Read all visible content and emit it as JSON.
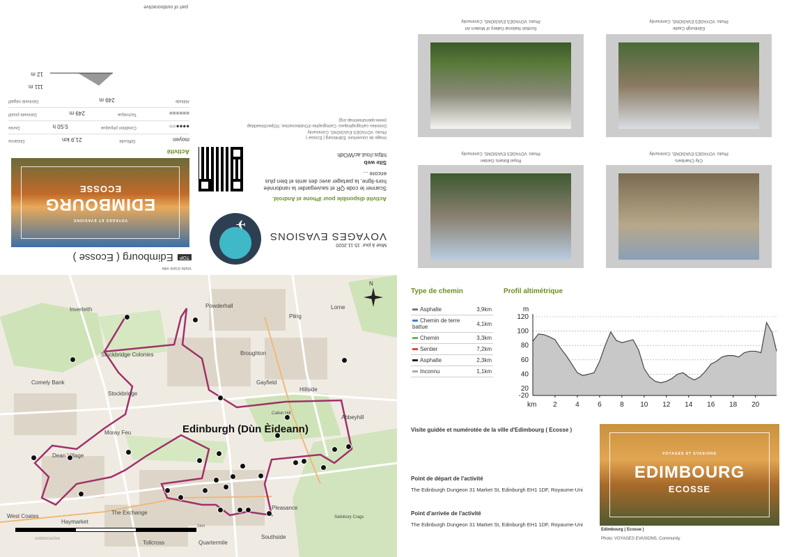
{
  "brand": {
    "part_of": "part of outdooractive",
    "name": "VOYAGES EVASIONS",
    "update": "Mise à jour: 15.11.2020"
  },
  "activity": {
    "category": "Visite d'une ville",
    "badge": "TOP",
    "title": "Edimbourg ( Ecosse )",
    "cover_title": "EDIMBOURG",
    "cover_sub": "ECOSSE",
    "cover_brand": "VOYAGES ET EVASIONS",
    "section": "Activité",
    "stats": [
      {
        "label": "Distance",
        "value": "21,9 km",
        "extra_label": "Difficulté",
        "extra_value": "moyen"
      },
      {
        "label": "Durée",
        "value": "5:50 h",
        "extra_label": "Condition physique",
        "extra_value": ""
      },
      {
        "label": "Dénivelé positif",
        "value": "249 m",
        "extra_label": "Technique",
        "extra_value": ""
      },
      {
        "label": "Dénivelé négatif",
        "value": "249 m",
        "extra_label": "Altitude",
        "extra_value": ""
      }
    ],
    "alt_max": "111 m",
    "alt_min": "12 m"
  },
  "app": {
    "heading": "Activité disponible pour iPhone et Android.",
    "desc": "Scanner le code QR et sauvegarder la randonnée hors-ligne, la partager avec des amis et bien plus encore ...",
    "site_label": "Site web",
    "site_url": "https://out.ac/WOdh",
    "credits1": "Image de couverture: Edimbourg ( Ecosse )",
    "credits2": "Photo: VOYAGES EVASIONS, Community",
    "credits3": "Données cartographiques: Cartographie d'Outdooractive; ©OpenStreetMap",
    "credits4": "(www.openstreetmap.org)"
  },
  "photos": [
    {
      "caption": "Scottish National Gallery of Modern Art",
      "credit": "Photo: VOYAGES EVASIONS, Community"
    },
    {
      "caption": "Edinburgh Castle",
      "credit": "Photo: VOYAGES EVASIONS, Community"
    },
    {
      "caption": "Royal Botanic Garden",
      "credit": "Photo: VOYAGES EVASIONS, Community"
    },
    {
      "caption": "City Chambers",
      "credit": "Photo: VOYAGES EVASIONS, Community"
    }
  ],
  "path_types": {
    "heading": "Type de chemin",
    "rows": [
      {
        "label": "Asphalte",
        "value": "3,9km",
        "color": "#777777"
      },
      {
        "label": "Chemin de terre battue",
        "value": "4,1km",
        "color": "#4a7cc9"
      },
      {
        "label": "Chemin",
        "value": "3,3km",
        "color": "#6bb34a"
      },
      {
        "label": "Sentier",
        "value": "7,2km",
        "color": "#e04040"
      },
      {
        "label": "Asphalte",
        "value": "2,3km",
        "color": "#222222"
      },
      {
        "label": "Inconnu",
        "value": "1,1km",
        "color": "#aaaaaa"
      }
    ]
  },
  "chart_data": {
    "type": "area",
    "title": "Profil altimétrique",
    "xlabel": "km",
    "ylabel": "m",
    "xlim": [
      0,
      21.9
    ],
    "ylim": [
      -20,
      120
    ],
    "xticks": [
      2,
      4,
      6,
      8,
      10,
      12,
      14,
      16,
      18,
      20
    ],
    "yticks": [
      -20,
      20,
      40,
      60,
      80,
      100,
      120
    ],
    "x": [
      0,
      0.5,
      1,
      1.5,
      2,
      2.5,
      3,
      3.5,
      4,
      4.5,
      5,
      5.5,
      6,
      6.5,
      7,
      7.5,
      8,
      8.5,
      9,
      9.5,
      10,
      10.5,
      11,
      11.5,
      12,
      12.5,
      13,
      13.5,
      14,
      14.5,
      15,
      15.5,
      16,
      16.5,
      17,
      17.5,
      18,
      18.5,
      19,
      19.5,
      20,
      20.5,
      21,
      21.5,
      21.9
    ],
    "y": [
      86,
      96,
      95,
      92,
      88,
      76,
      66,
      54,
      42,
      38,
      40,
      42,
      58,
      80,
      99,
      87,
      84,
      86,
      88,
      74,
      48,
      36,
      30,
      28,
      30,
      34,
      40,
      42,
      36,
      32,
      36,
      44,
      54,
      58,
      64,
      66,
      66,
      64,
      70,
      72,
      72,
      70,
      112,
      98,
      72
    ]
  },
  "route": {
    "title": "Visite guidée et numérotée de la ville d'Edimbourg ( Ecosse )",
    "start_heading": "Point de départ de l'activité",
    "start_addr": "The Edinburgh Dungeon 31 Market St, Edinburgh EH1 1DF, Royaume-Uni",
    "end_heading": "Point d'arrivée de l'activité",
    "end_addr": "The Edinburgh Dungeon 31 Market St, Edinburgh EH1 1DF, Royaume-Uni",
    "cover_caption": "Edimbourg ( Ecosse )",
    "cover_credit": "Photo: VOYAGES EVASIONS, Community"
  },
  "map": {
    "city": "Edinburgh (Dùn Èideann)",
    "labels": [
      "Inverleith",
      "Powderhall",
      "Lorne",
      "Pilrig",
      "Stockbridge Colonies",
      "Broughton",
      "Comely Bank",
      "Stockbridge",
      "Gayfield",
      "Hillside",
      "Abbeyhill",
      "Moray Feu",
      "Dean Village",
      "West Coates",
      "Haymarket",
      "The Exchange",
      "Tollcross",
      "Quartermile",
      "Southside",
      "Pleasance",
      "Salisbury Crags",
      "Calton Hill"
    ],
    "scale": "1km",
    "watermark": "outdooractive",
    "north": "N"
  },
  "colors": {
    "route": "#a0306a",
    "accent": "#6b8e23",
    "teal": "#3fb8c8"
  }
}
